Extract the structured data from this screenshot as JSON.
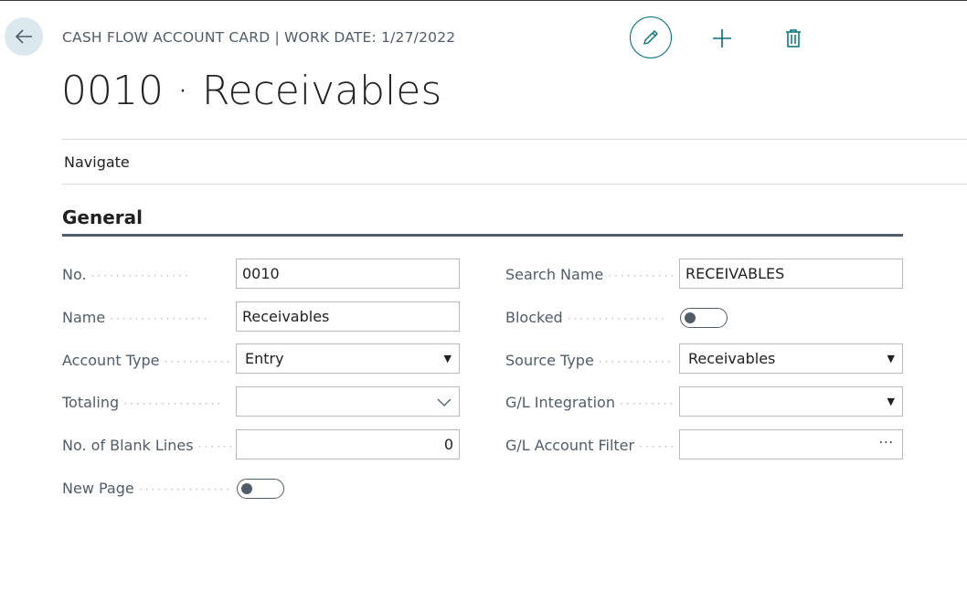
{
  "header": {
    "caption": "CASH FLOW ACCOUNT CARD | WORK DATE: 1/27/2022",
    "title": "0010 · Receivables"
  },
  "actions": {
    "back": "back-arrow-icon",
    "edit": "pencil-icon",
    "new": "plus-icon",
    "delete": "trash-icon"
  },
  "menu": {
    "navigate": "Navigate"
  },
  "section": {
    "title": "General"
  },
  "left": {
    "no": {
      "label": "No.",
      "value": "0010"
    },
    "name": {
      "label": "Name",
      "value": "Receivables"
    },
    "account_type": {
      "label": "Account Type",
      "value": "Entry"
    },
    "totaling": {
      "label": "Totaling",
      "value": ""
    },
    "blank_lines": {
      "label": "No. of Blank Lines",
      "value": "0"
    },
    "new_page": {
      "label": "New Page",
      "on": false
    }
  },
  "right": {
    "search_name": {
      "label": "Search Name",
      "value": "RECEIVABLES"
    },
    "blocked": {
      "label": "Blocked",
      "on": false
    },
    "source_type": {
      "label": "Source Type",
      "value": "Receivables"
    },
    "gl_integration": {
      "label": "G/L Integration",
      "value": ""
    },
    "gl_account_filter": {
      "label": "G/L Account Filter",
      "value": "",
      "lookup": "···"
    }
  },
  "colors": {
    "accent": "#00707a",
    "label": "#505c6a",
    "border": "#b9b9b9"
  }
}
